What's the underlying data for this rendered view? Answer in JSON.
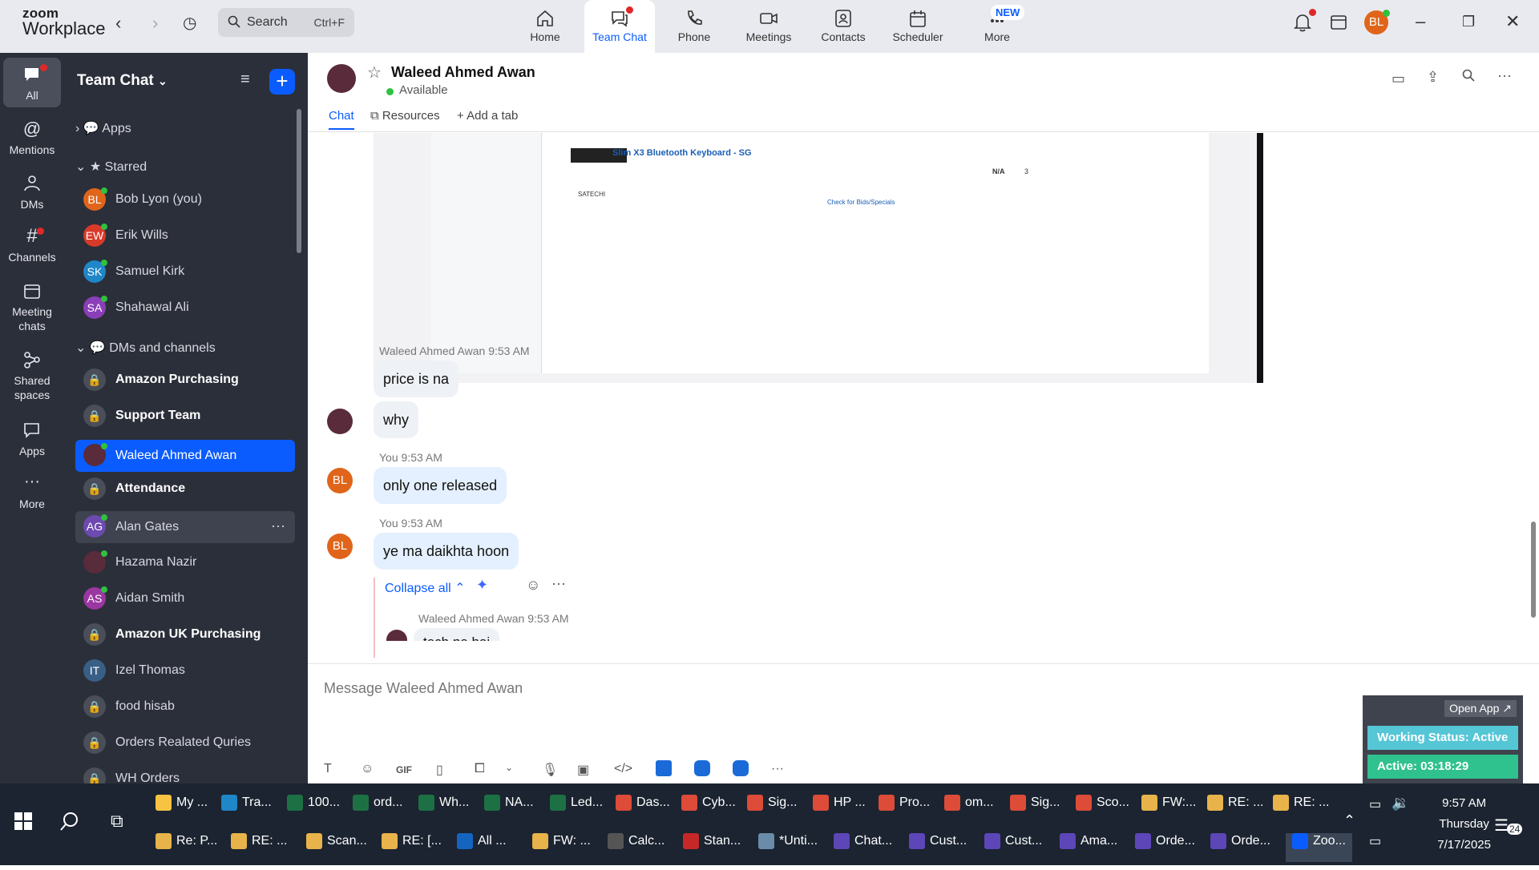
{
  "app": {
    "brand_line1": "zoom",
    "brand_line2": "Workplace"
  },
  "topbar": {
    "search_label": "Search",
    "search_shortcut": "Ctrl+F",
    "tabs": [
      {
        "label": "Home",
        "icon": "home-icon"
      },
      {
        "label": "Team Chat",
        "icon": "team-chat-icon",
        "active": true
      },
      {
        "label": "Phone",
        "icon": "phone-icon"
      },
      {
        "label": "Meetings",
        "icon": "video-camera-icon"
      },
      {
        "label": "Contacts",
        "icon": "contacts-icon"
      },
      {
        "label": "Scheduler",
        "icon": "calendar-icon"
      },
      {
        "label": "More",
        "icon": "more-icon"
      }
    ],
    "new_badge": "NEW",
    "user_initials": "BL"
  },
  "rail": [
    {
      "label": "All",
      "icon": "chat-bubble-icon"
    },
    {
      "label": "Mentions",
      "icon": "at-icon"
    },
    {
      "label": "DMs",
      "icon": "people-icon"
    },
    {
      "label": "Channels",
      "icon": "hash-icon"
    },
    {
      "label": "Meeting\nchats",
      "icon": "calendar-icon"
    },
    {
      "label": "Shared\nspaces",
      "icon": "network-icon"
    },
    {
      "label": "Apps",
      "icon": "apps-icon"
    },
    {
      "label": "More",
      "icon": "ellipsis-icon"
    }
  ],
  "sidebar": {
    "title": "Team Chat",
    "sections": {
      "apps": "Apps",
      "starred": "Starred",
      "dms": "DMs and channels"
    },
    "starred": [
      {
        "name": "Bob Lyon (you)",
        "initials": "BL",
        "color": "#e0651a"
      },
      {
        "name": "Erik Wills",
        "initials": "EW",
        "color": "#d83a2a"
      },
      {
        "name": "Samuel Kirk",
        "initials": "SK",
        "color": "#1f86c8"
      },
      {
        "name": "Shahawal Ali",
        "initials": "SA",
        "color": "#8a3fb8"
      }
    ],
    "channels": [
      {
        "name": "Amazon Purchasing",
        "bold": true,
        "lock": true
      },
      {
        "name": "Support Team",
        "bold": true,
        "lock": true
      },
      {
        "name": "Waleed Ahmed Awan",
        "selected": true
      },
      {
        "name": "Attendance",
        "bold": true,
        "lock": true
      },
      {
        "name": "Alan Gates",
        "initials": "AG",
        "color": "#6c4ab0",
        "hover": true
      },
      {
        "name": "Hazama Nazir",
        "initials": "",
        "color": "#5a2b3a"
      },
      {
        "name": "Aidan Smith",
        "initials": "AS",
        "color": "#9a37a0"
      },
      {
        "name": "Amazon UK Purchasing",
        "bold": true,
        "lock": true
      },
      {
        "name": "Izel Thomas",
        "initials": "IT",
        "color": "#3a5f86"
      },
      {
        "name": "food hisab",
        "lock": true
      },
      {
        "name": "Orders Realated Quries",
        "lock": true
      },
      {
        "name": "WH Orders",
        "lock": true
      }
    ]
  },
  "chat": {
    "contact_name": "Waleed Ahmed Awan",
    "contact_status": "Available",
    "tabs": {
      "chat": "Chat",
      "resources": "Resources",
      "add": "Add a tab"
    },
    "screenshot": {
      "product_title": "Slim X3 Bluetooth Keyboard - SG",
      "price": "N/A",
      "qty": "3",
      "brand": "SATECHI",
      "link": "Check for Bids/Specials"
    },
    "messages": [
      {
        "sender": "Waleed Ahmed Awan",
        "time": "9:53 AM",
        "texts": [
          "price is na",
          "why"
        ]
      },
      {
        "sender": "You",
        "time": "9:53 AM",
        "texts": [
          "only one released"
        ]
      },
      {
        "sender": "You",
        "time": "9:53 AM",
        "texts": [
          "ye ma daikhta hoon"
        ]
      }
    ],
    "collapse_label": "Collapse all",
    "reply": {
      "sender": "Waleed Ahmed Awan",
      "time": "9:53 AM",
      "text": "tech ne hai"
    },
    "compose_placeholder": "Message Waleed Ahmed Awan"
  },
  "widget": {
    "open_app": "Open App ↗",
    "working_status": "Working Status: Active",
    "active_timer": "Active: 03:18:29"
  },
  "taskbar": {
    "row1": [
      "My ...",
      "Tra...",
      "100...",
      "ord...",
      "Wh...",
      "NA...",
      "Led...",
      "Das...",
      "Cyb...",
      "Sig...",
      "HP ...",
      "Pro...",
      "om...",
      "Sig...",
      "Sco...",
      "FW:...",
      "RE: ...",
      "RE: ..."
    ],
    "row2": [
      "Re: P...",
      "RE: ...",
      "Scan...",
      "RE: [...",
      "All ...",
      "FW: ...",
      "Calc...",
      "Stan...",
      "*Unti...",
      "Chat...",
      "Cust...",
      "Cust...",
      "Ama...",
      "Orde...",
      "Orde...",
      "Zoo..."
    ],
    "time": "9:57 AM",
    "day": "Thursday",
    "date": "7/17/2025",
    "notif_count": "24"
  }
}
